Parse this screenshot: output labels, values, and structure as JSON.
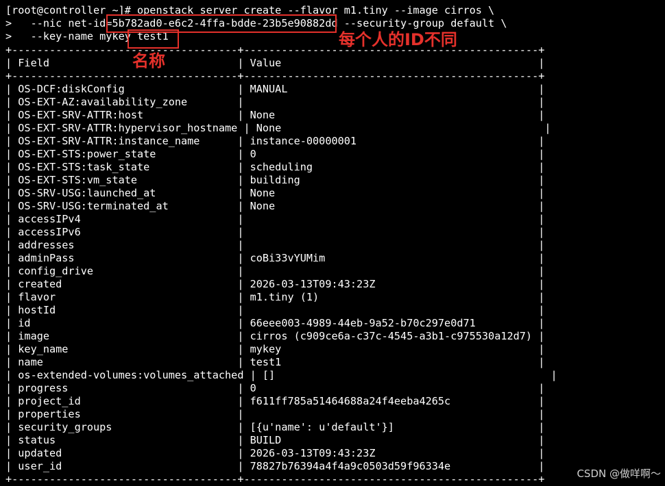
{
  "terminal": {
    "cmd_line_1": "[root@controller ~]# openstack server create --flavor m1.tiny --image cirros \\",
    "cmd_line_2": ">   --nic net-id=5b782ad0-e6c2-4ffa-bdde-23b5e90882dd --security-group default \\",
    "cmd_line_3": ">   --key-name mykey test1",
    "border": "+------------------------------------+-----------------------------------------------+",
    "header": "| Field                              | Value                                         |",
    "rows": [
      "| OS-DCF:diskConfig                  | MANUAL                                        |",
      "| OS-EXT-AZ:availability_zone        |                                               |",
      "| OS-EXT-SRV-ATTR:host               | None                                          |",
      "| OS-EXT-SRV-ATTR:hypervisor_hostname | None                                          |",
      "| OS-EXT-SRV-ATTR:instance_name      | instance-00000001                             |",
      "| OS-EXT-STS:power_state             | 0                                             |",
      "| OS-EXT-STS:task_state              | scheduling                                    |",
      "| OS-EXT-STS:vm_state                | building                                      |",
      "| OS-SRV-USG:launched_at             | None                                          |",
      "| OS-SRV-USG:terminated_at           | None                                          |",
      "| accessIPv4                         |                                               |",
      "| accessIPv6                         |                                               |",
      "| addresses                          |                                               |",
      "| adminPass                          | coBi33vYUMim                                  |",
      "| config_drive                       |                                               |",
      "| created                            | 2026-03-13T09:43:23Z                          |",
      "| flavor                             | m1.tiny (1)                                   |",
      "| hostId                             |                                               |",
      "| id                                 | 66eee003-4989-44eb-9a52-b70c297e0d71          |",
      "| image                              | cirros (c909ce6a-c37c-4545-a3b1-c975530a12d7) |",
      "| key_name                           | mykey                                         |",
      "| name                               | test1                                         |",
      "| os-extended-volumes:volumes_attached | []                                            |",
      "| progress                           | 0                                             |",
      "| project_id                         | f611ff785a51464688a24f4eeba4265c              |",
      "| properties                         |                                               |",
      "| security_groups                    | [{u'name': u'default'}]                       |",
      "| status                             | BUILD                                         |",
      "| updated                            | 2026-03-13T09:43:23Z                          |",
      "| user_id                            | 78827b76394a4f4a9c0503d59f96334e              |"
    ]
  },
  "annotations": {
    "id_note": "每个人的ID不同",
    "name_note": "名称",
    "color": "#e5312b"
  },
  "watermark": "CSDN @做咩啊～"
}
